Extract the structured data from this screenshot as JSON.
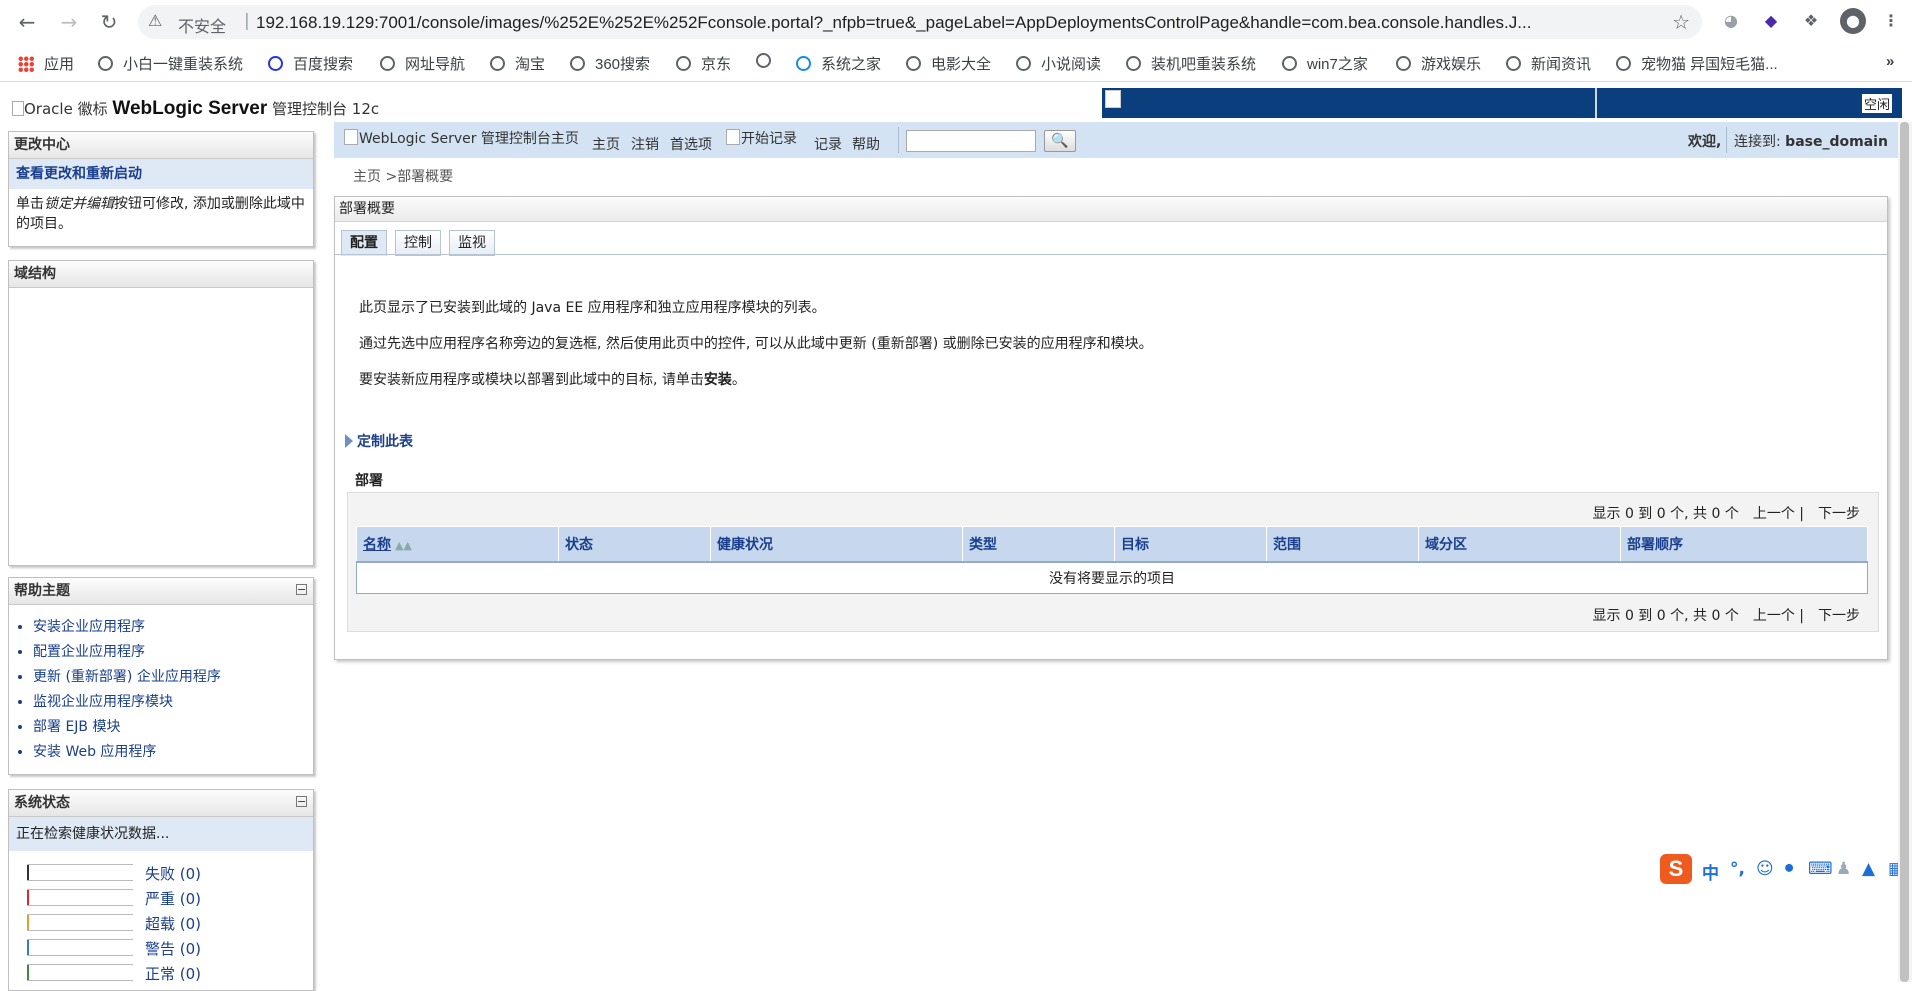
{
  "browser": {
    "insecure_label": "不安全",
    "url": "192.168.19.129:7001/console/images/%252E%252E%252Fconsole.portal?_nfpb=true&_pageLabel=AppDeploymentsControlPage&handle=com.bea.console.handles.J...",
    "bookmarks": [
      "应用",
      "小白一键重装系统",
      "百度搜索",
      "网址导航",
      "淘宝",
      "360搜索",
      "京东",
      "系统之家",
      "电影大全",
      "小说阅读",
      "装机吧重装系统",
      "win7之家",
      "游戏娱乐",
      "新闻资讯",
      "宠物猫 异国短毛猫..."
    ]
  },
  "header": {
    "logo_alt": "Oracle 徽标",
    "product": "WebLogic Server",
    "subtitle": "管理控制台 12c",
    "banner_idle": "空闲"
  },
  "change_center": {
    "title": "更改中心",
    "link": "查看更改和重新启动",
    "text_prefix": "单击",
    "text_italic": "锁定并编辑",
    "text_suffix": "按钮可修改, 添加或删除此域中的项目。"
  },
  "domain_structure": {
    "title": "域结构"
  },
  "help_topics": {
    "title": "帮助主题",
    "items": [
      "安装企业应用程序",
      "配置企业应用程序",
      "更新 (重新部署) 企业应用程序",
      "监视企业应用程序模块",
      "部署 EJB 模块",
      "安装 Web 应用程序"
    ]
  },
  "system_status": {
    "title": "系统状态",
    "loading": "正在检索健康状况数据...",
    "rows": [
      {
        "label": "失败 (0)",
        "color": "#333333"
      },
      {
        "label": "严重 (0)",
        "color": "#d62b2b"
      },
      {
        "label": "超载 (0)",
        "color": "#e0a030"
      },
      {
        "label": "警告 (0)",
        "color": "#3a7bbf"
      },
      {
        "label": "正常 (0)",
        "color": "#3e8a3e"
      }
    ]
  },
  "toolbar": {
    "home_img_alt": "WebLogic Server 管理控制台主页",
    "home": "主页",
    "logout": "注销",
    "prefs": "首选项",
    "record_img_alt": "开始记录",
    "record": "记录",
    "help": "帮助",
    "welcome": "欢迎,",
    "connected": "连接到:",
    "domain": "base_domain"
  },
  "breadcrumb": {
    "home": "主页",
    "sep": " >",
    "current": "部署概要"
  },
  "content": {
    "title": "部署概要",
    "tabs": [
      "配置",
      "控制",
      "监视"
    ],
    "desc1": "此页显示了已安装到此域的 Java EE 应用程序和独立应用程序模块的列表。",
    "desc2": "通过先选中应用程序名称旁边的复选框, 然后使用此页中的控件, 可以从此域中更新 (重新部署) 或删除已安装的应用程序和模块。",
    "desc3_prefix": "要安装新应用程序或模块以部署到此域中的目标, 请单击",
    "desc3_bold": "安装",
    "desc3_suffix": "。",
    "customize": "定制此表",
    "deploy_title": "部署",
    "pager_text": "显示 0 到 0 个, 共 0 个",
    "prev": "上一个 |",
    "next": "下一步",
    "columns": [
      "名称",
      "状态",
      "健康状况",
      "类型",
      "目标",
      "范围",
      "域分区",
      "部署顺序"
    ],
    "empty": "没有将要显示的项目"
  },
  "ime": {
    "lang": "中"
  }
}
